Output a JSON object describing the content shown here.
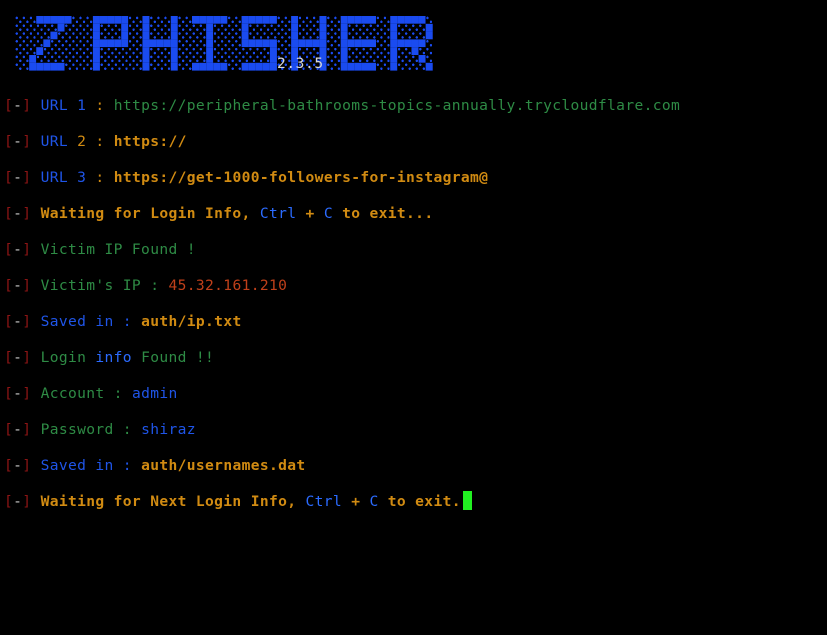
{
  "app": {
    "name": "zphisher",
    "logo_text": "ZPHISHER",
    "version": "2.3.5",
    "logo_color": "#1A4BF0",
    "background": "#000000"
  },
  "theme": {
    "bracket": "#8C1515",
    "dash": "#C8C8C8",
    "blue": "#1F55E8",
    "green": "#2E8B45",
    "orange": "#D18B12",
    "red": "#C0401A",
    "white": "#D8D8D8",
    "cursor": "#21F021"
  },
  "prefix": {
    "open": "[",
    "dash": "-",
    "close": "]"
  },
  "lines": [
    {
      "id": "url-1",
      "segments": [
        {
          "text": "URL",
          "color": "blue"
        },
        {
          "text": " ",
          "color": "white"
        },
        {
          "text": "1",
          "color": "blue"
        },
        {
          "text": " ",
          "color": "white"
        },
        {
          "text": ":",
          "color": "orange"
        },
        {
          "text": " ",
          "color": "white"
        },
        {
          "text": "https://peripheral-bathrooms-topics-annually.trycloudflare.com",
          "color": "green"
        }
      ]
    },
    {
      "id": "url-2",
      "segments": [
        {
          "text": "URL",
          "color": "blue"
        },
        {
          "text": " ",
          "color": "white"
        },
        {
          "text": "2",
          "color": "orange"
        },
        {
          "text": " ",
          "color": "white"
        },
        {
          "text": ":",
          "color": "orange"
        },
        {
          "text": " ",
          "color": "white"
        },
        {
          "text": "https://",
          "color": "orange-bold"
        }
      ]
    },
    {
      "id": "url-3",
      "segments": [
        {
          "text": "URL",
          "color": "blue"
        },
        {
          "text": " ",
          "color": "white"
        },
        {
          "text": "3",
          "color": "blue"
        },
        {
          "text": " ",
          "color": "white"
        },
        {
          "text": ":",
          "color": "orange"
        },
        {
          "text": " ",
          "color": "white"
        },
        {
          "text": "https://get-1000-followers-for-instagram@",
          "color": "orange-bold"
        }
      ]
    },
    {
      "id": "waiting-login",
      "segments": [
        {
          "text": "Waiting for Login Info, ",
          "color": "orange-bold"
        },
        {
          "text": "Ctrl",
          "color": "blue-bold"
        },
        {
          "text": " + ",
          "color": "orange-bold"
        },
        {
          "text": "C",
          "color": "blue-bold"
        },
        {
          "text": " to exit...",
          "color": "orange-bold"
        }
      ]
    },
    {
      "id": "victim-ip-found",
      "segments": [
        {
          "text": "Victim IP Found !",
          "color": "green"
        }
      ]
    },
    {
      "id": "victim-ip-value",
      "segments": [
        {
          "text": "Victim's IP : ",
          "color": "green"
        },
        {
          "text": "45.32.161.210",
          "color": "red"
        }
      ]
    },
    {
      "id": "saved-ip",
      "segments": [
        {
          "text": "Saved ",
          "color": "blue"
        },
        {
          "text": "in",
          "color": "blue"
        },
        {
          "text": " : ",
          "color": "blue"
        },
        {
          "text": "auth/ip.txt",
          "color": "orange-bold"
        }
      ]
    },
    {
      "id": "login-info-found",
      "segments": [
        {
          "text": "Login ",
          "color": "green"
        },
        {
          "text": "info",
          "color": "blue-bold"
        },
        {
          "text": " Found !!",
          "color": "green"
        }
      ]
    },
    {
      "id": "account",
      "segments": [
        {
          "text": "Account : ",
          "color": "green"
        },
        {
          "text": "admin",
          "color": "blue"
        }
      ]
    },
    {
      "id": "password",
      "segments": [
        {
          "text": "Password : ",
          "color": "green"
        },
        {
          "text": "shiraz",
          "color": "blue"
        }
      ]
    },
    {
      "id": "saved-usernames",
      "segments": [
        {
          "text": "Saved ",
          "color": "blue"
        },
        {
          "text": "in",
          "color": "blue"
        },
        {
          "text": " : ",
          "color": "blue"
        },
        {
          "text": "auth/usernames.dat",
          "color": "orange-bold"
        }
      ]
    },
    {
      "id": "waiting-next-login",
      "cursor": true,
      "segments": [
        {
          "text": "Waiting for Next Login Info, ",
          "color": "orange-bold"
        },
        {
          "text": "Ctrl",
          "color": "blue-bold"
        },
        {
          "text": " + ",
          "color": "orange-bold"
        },
        {
          "text": "C",
          "color": "blue-bold"
        },
        {
          "text": " to exit.",
          "color": "orange-bold"
        }
      ]
    }
  ],
  "logo_bitmap": {
    "cols": 43,
    "rows": 9,
    "legend": {
      "1": "filled-block",
      "0": "dotted-background",
      ".": "empty"
    },
    "rows_data": [
      "0111110001111100010001000111110011111000100010001111100",
      "0000110001000010010001000001000010000000100010001000010",
      "0001100001000010010001000001000010000000100010001000010",
      "0011000001111100011111000001000011111000111110001111100",
      "0110000001000000010001000001000000001000100010001001000",
      "1100000001000000010001000001000000001000100010001000100",
      "1111110001000000010001000111110011111000100010001000010"
    ]
  }
}
